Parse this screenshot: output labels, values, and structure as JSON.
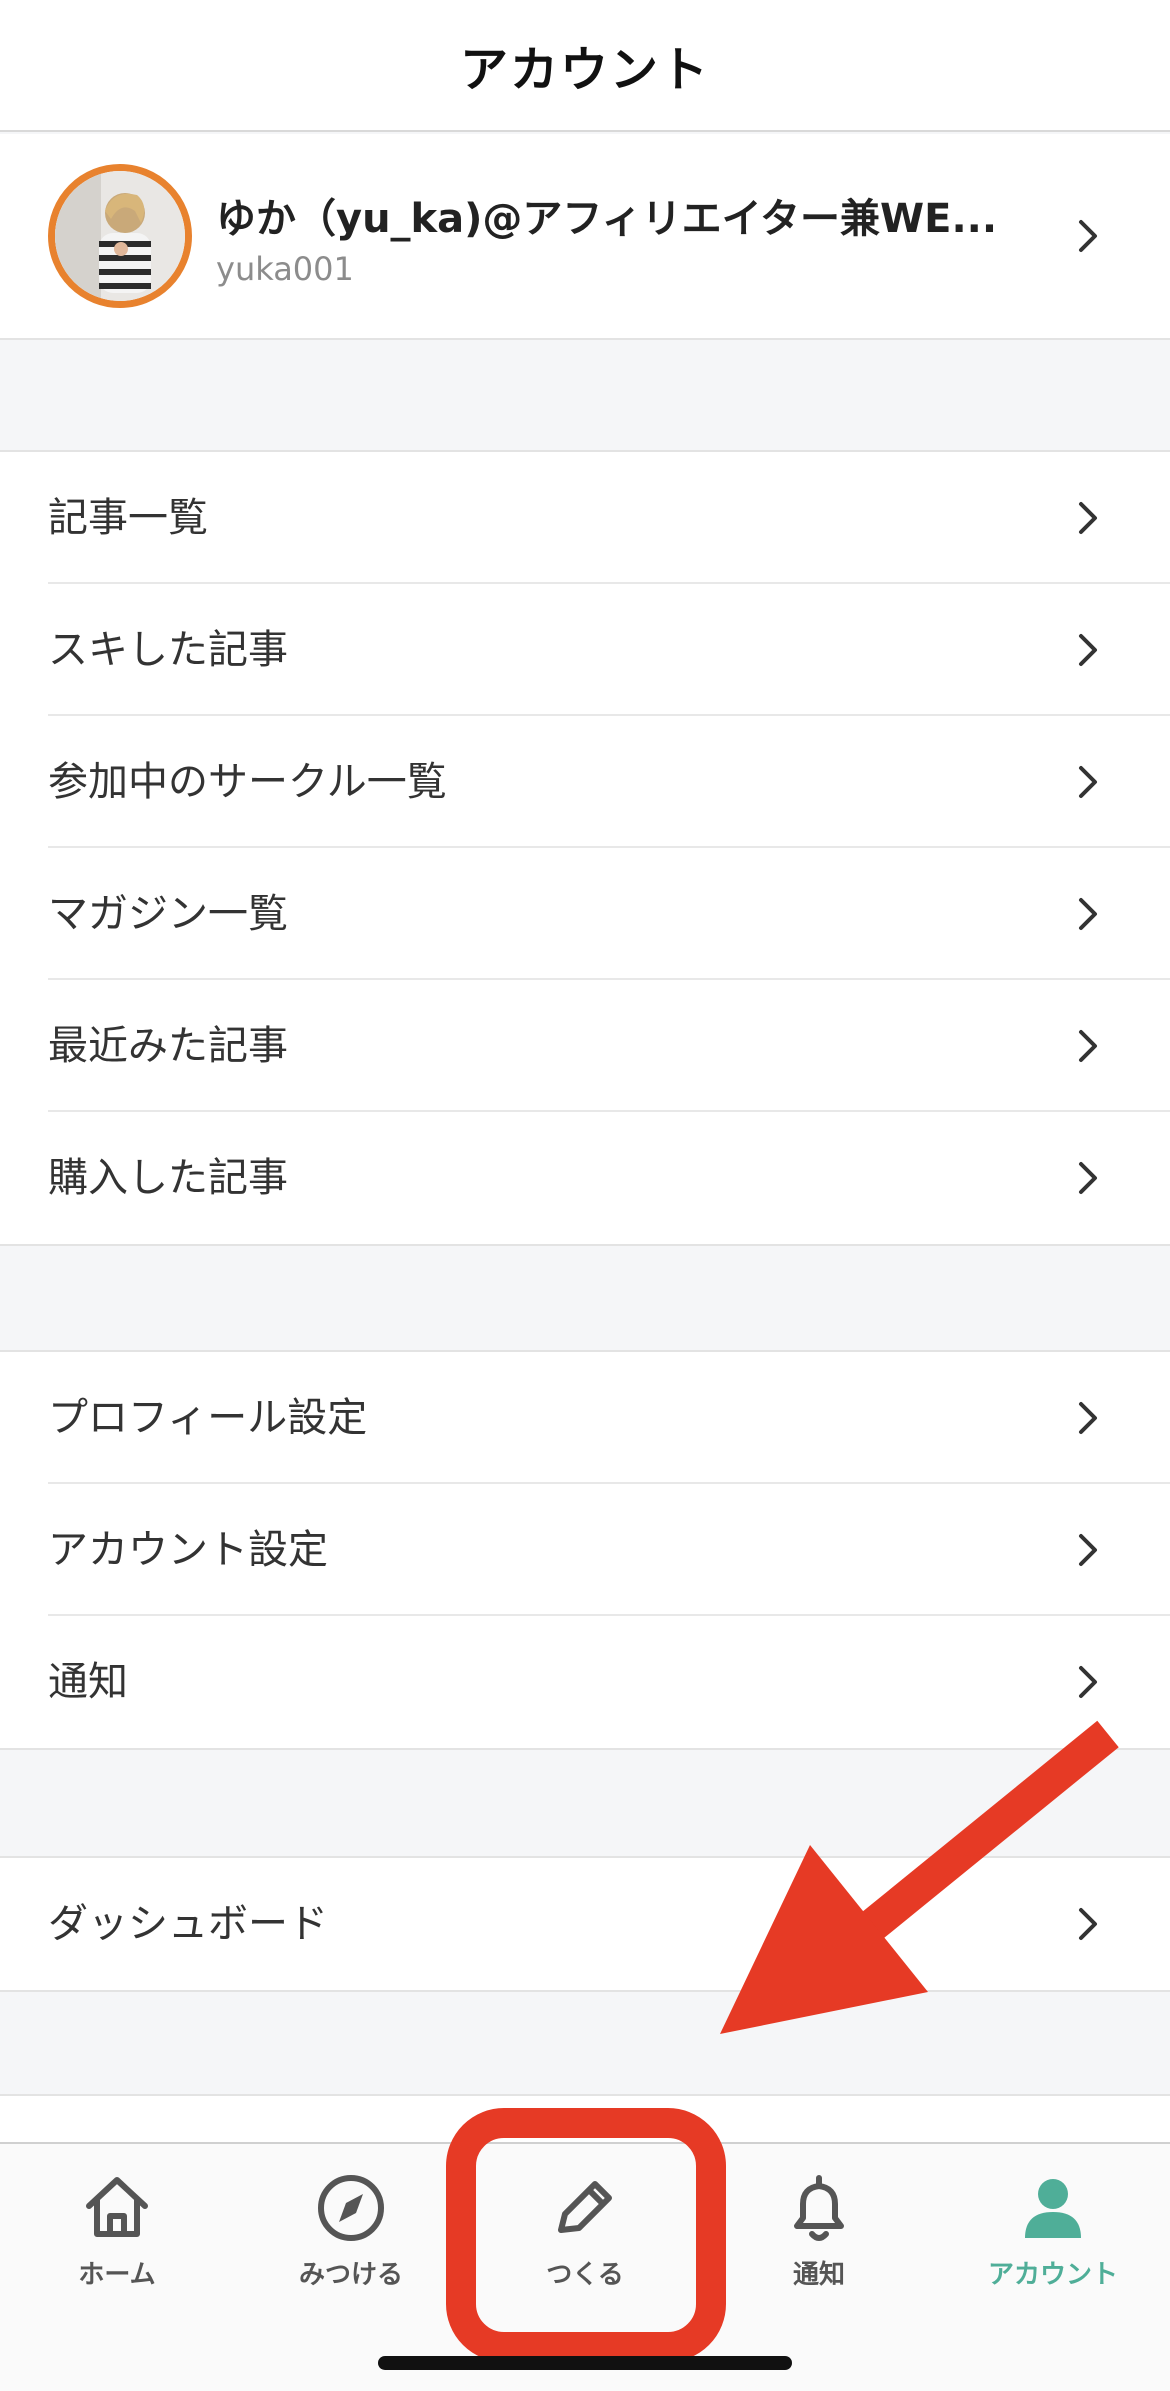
{
  "header": {
    "title": "アカウント"
  },
  "profile": {
    "name": "ゆか（yu_ka)@アフィリエイター兼WE...",
    "id": "yuka001"
  },
  "menu_content": [
    {
      "label": "記事一覧"
    },
    {
      "label": "スキした記事"
    },
    {
      "label": "参加中のサークル一覧"
    },
    {
      "label": "マガジン一覧"
    },
    {
      "label": "最近みた記事"
    },
    {
      "label": "購入した記事"
    }
  ],
  "menu_settings": [
    {
      "label": "プロフィール設定"
    },
    {
      "label": "アカウント設定"
    },
    {
      "label": "通知"
    }
  ],
  "menu_dashboard": [
    {
      "label": "ダッシュボード"
    }
  ],
  "tabbar": {
    "tabs": [
      {
        "label": "ホーム",
        "icon": "home-icon"
      },
      {
        "label": "みつける",
        "icon": "compass-icon"
      },
      {
        "label": "つくる",
        "icon": "pencil-icon"
      },
      {
        "label": "通知",
        "icon": "bell-icon"
      },
      {
        "label": "アカウント",
        "icon": "person-icon"
      }
    ],
    "active_index": 4
  },
  "colors": {
    "accent": "#4fae98",
    "annotation": "#e63a25",
    "avatar_ring": "#e8822e"
  }
}
